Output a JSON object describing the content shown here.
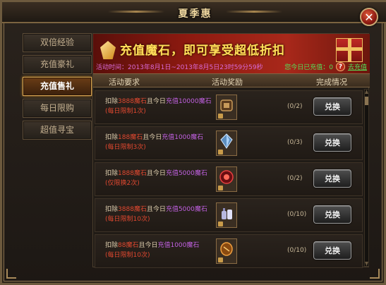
{
  "window": {
    "title": "夏季惠"
  },
  "sidebar": {
    "items": [
      {
        "label": "双倍经验"
      },
      {
        "label": "充值豪礼"
      },
      {
        "label": "充值售礼",
        "active": true
      },
      {
        "label": "每日限购"
      },
      {
        "label": "超值寻宝"
      }
    ]
  },
  "banner": {
    "headline": "充值魔石，即可享受超低折扣",
    "activity_time": "活动时间：2013年8月1日~2013年8月5日23时59分59秒",
    "today_recharge": "您今日已充值：0",
    "go_link": "去充值"
  },
  "table": {
    "headers": [
      "活动要求",
      "活动奖励",
      "完成情况"
    ],
    "rows": [
      {
        "req_prefix": "扣除",
        "req_amount": "3888魔石",
        "req_mid": "且今日",
        "req_recharge": "充值10000魔石",
        "limit": "(每日限制1次)",
        "count": "(0/2)",
        "button": "兑换",
        "item_color": "#c89a5a",
        "icon": "armor-icon"
      },
      {
        "req_prefix": "扣除",
        "req_amount": "188魔石",
        "req_mid": "且今日",
        "req_recharge": "充值1000魔石",
        "limit": "(每日限制3次)",
        "count": "(0/3)",
        "button": "兑换",
        "item_color": "#8ab8e8",
        "icon": "crystal-icon"
      },
      {
        "req_prefix": "扣除",
        "req_amount": "1888魔石",
        "req_mid": "且今日",
        "req_recharge": "充值5000魔石",
        "limit": "(仅限换2次)",
        "count": "(0/2)",
        "button": "兑换",
        "item_color": "#d83a3a",
        "icon": "orb-icon"
      },
      {
        "req_prefix": "扣除",
        "req_amount": "3888魔石",
        "req_mid": "且今日",
        "req_recharge": "充值5000魔石",
        "limit": "(每日限制10次)",
        "count": "(0/10)",
        "button": "兑换",
        "item_color": "#c8c8e8",
        "icon": "bottle-icon"
      },
      {
        "req_prefix": "扣除",
        "req_amount": "88魔石",
        "req_mid": "且今日",
        "req_recharge": "充值1000魔石",
        "limit": "(每日限制10次)",
        "count": "(0/10)",
        "button": "兑换",
        "item_color": "#d08a2a",
        "icon": "stone-icon"
      }
    ]
  }
}
